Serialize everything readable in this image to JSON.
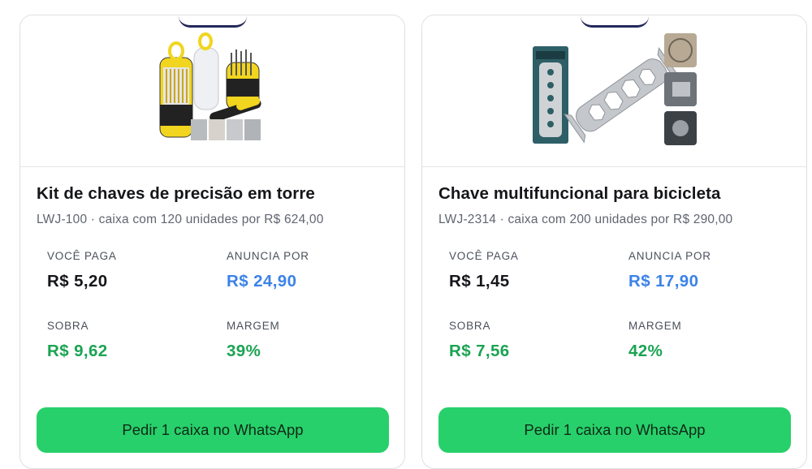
{
  "products": [
    {
      "title": "Kit de chaves de precisão em torre",
      "subtitle": "LWJ-100 · caixa com 120 unidades por R$ 624,00",
      "image_icon": "precision-screwdriver-kit-photo",
      "you_pay_label": "VOCÊ PAGA",
      "you_pay_value": "R$ 5,20",
      "list_price_label": "ANUNCIA POR",
      "list_price_value": "R$ 24,90",
      "profit_label": "SOBRA",
      "profit_value": "R$ 9,62",
      "margin_label": "MARGEM",
      "margin_value": "39%",
      "button_label": "Pedir 1 caixa no WhatsApp"
    },
    {
      "title": "Chave multifuncional para bicicleta",
      "subtitle": "LWJ-2314 · caixa com 200 unidades por R$ 290,00",
      "image_icon": "bicycle-multi-wrench-photo",
      "you_pay_label": "VOCÊ PAGA",
      "you_pay_value": "R$ 1,45",
      "list_price_label": "ANUNCIA POR",
      "list_price_value": "R$ 17,90",
      "profit_label": "SOBRA",
      "profit_value": "R$ 7,56",
      "margin_label": "MARGEM",
      "margin_value": "42%",
      "button_label": "Pedir 1 caixa no WhatsApp"
    }
  ],
  "colors": {
    "you_pay": "#15161a",
    "list_price": "#3b82e8",
    "profit": "#1aa352",
    "button": "#27d06a"
  }
}
